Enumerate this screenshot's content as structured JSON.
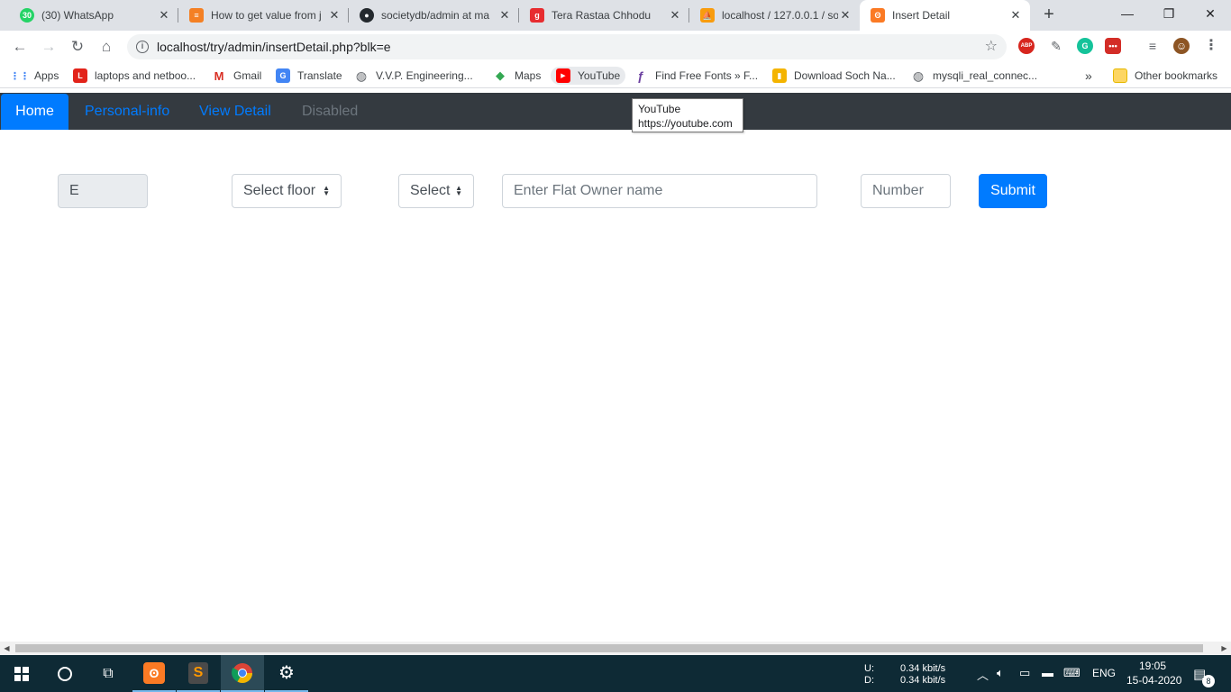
{
  "browser": {
    "tabs": [
      {
        "title": "(30) WhatsApp",
        "icon": "whatsapp-icon",
        "color": "#25d366",
        "glyph": "30"
      },
      {
        "title": "How to get value from j",
        "icon": "stackoverflow-icon",
        "color": "#f48024",
        "glyph": "≡"
      },
      {
        "title": "societydb/admin at ma",
        "icon": "github-icon",
        "color": "#24292e",
        "glyph": "●"
      },
      {
        "title": "Tera Rastaa Chhodu",
        "icon": "gaana-icon",
        "color": "#e72c30",
        "glyph": "g"
      },
      {
        "title": "localhost / 127.0.0.1 / so",
        "icon": "phpmyadmin-icon",
        "color": "#f89c0e",
        "glyph": "⛵"
      },
      {
        "title": "Insert Detail",
        "icon": "xampp-icon",
        "color": "#fb7a24",
        "glyph": "ʘ"
      }
    ],
    "new_tab_label": "+",
    "window_controls": {
      "minimize": "—",
      "restore": "❐",
      "close": "✕"
    },
    "url": "localhost/try/admin/insertDetail.php?blk=e",
    "extensions": [
      {
        "name": "adblock-icon",
        "color": "#d7261e",
        "glyph": "ABP"
      },
      {
        "name": "eyedropper-icon",
        "color": "#5f6368",
        "glyph": "✎"
      },
      {
        "name": "grammarly-icon",
        "color": "#15c39a",
        "glyph": "G"
      },
      {
        "name": "lastpass-icon",
        "color": "#d32d27",
        "glyph": "•••"
      },
      {
        "name": "media-control-icon",
        "color": "#5f6368",
        "glyph": "≡"
      },
      {
        "name": "profile-avatar",
        "color": "#8d5524",
        "glyph": "☺"
      },
      {
        "name": "menu-icon",
        "color": "#5f6368",
        "glyph": "⋮"
      }
    ],
    "bookmarks": [
      {
        "label": "Apps",
        "icon": "apps-grid-icon",
        "color": "#4285f4",
        "glyph": "⋮⋮"
      },
      {
        "label": "laptops and netboo...",
        "icon": "lenovo-icon",
        "color": "#e2231a",
        "glyph": "L"
      },
      {
        "label": "Gmail",
        "icon": "gmail-icon",
        "color": "#d93025",
        "glyph": "M"
      },
      {
        "label": "Translate",
        "icon": "translate-icon",
        "color": "#4285f4",
        "glyph": "G"
      },
      {
        "label": "V.V.P. Engineering...",
        "icon": "globe-icon",
        "color": "#5f6368",
        "glyph": "◍"
      },
      {
        "label": "Maps",
        "icon": "maps-icon",
        "color": "#34a853",
        "glyph": "◆"
      },
      {
        "label": "YouTube",
        "icon": "youtube-icon",
        "color": "#ff0000",
        "glyph": "▶"
      },
      {
        "label": "Find Free Fonts » F...",
        "icon": "fonts-icon",
        "color": "#6b3fa0",
        "glyph": "ƒ"
      },
      {
        "label": "Download Soch Na...",
        "icon": "download-icon",
        "color": "#f4b400",
        "glyph": "▮"
      },
      {
        "label": "mysqli_real_connec...",
        "icon": "globe-icon",
        "color": "#5f6368",
        "glyph": "◍"
      }
    ],
    "bookmarks_overflow": "»",
    "other_bookmarks": "Other bookmarks",
    "tooltip": {
      "title": "YouTube",
      "url": "https://youtube.com"
    }
  },
  "page": {
    "nav": {
      "home": "Home",
      "personal_info": "Personal-info",
      "view_detail": "View Detail",
      "disabled": "Disabled"
    },
    "form": {
      "block_value": "E",
      "floor_select": "Select floor",
      "flat_select": "Select",
      "owner_placeholder": "Enter Flat Owner name",
      "number_placeholder": "Number",
      "submit": "Submit"
    },
    "colors": {
      "primary": "#007bff",
      "navbar": "#343a40",
      "disabled": "#6c757d"
    }
  },
  "taskbar": {
    "net_up_label": "U:",
    "net_down_label": "D:",
    "net_up": "0.34 kbit/s",
    "net_down": "0.34 kbit/s",
    "language": "ENG",
    "time": "19:05",
    "date": "15-04-2020",
    "notifications": "8"
  }
}
